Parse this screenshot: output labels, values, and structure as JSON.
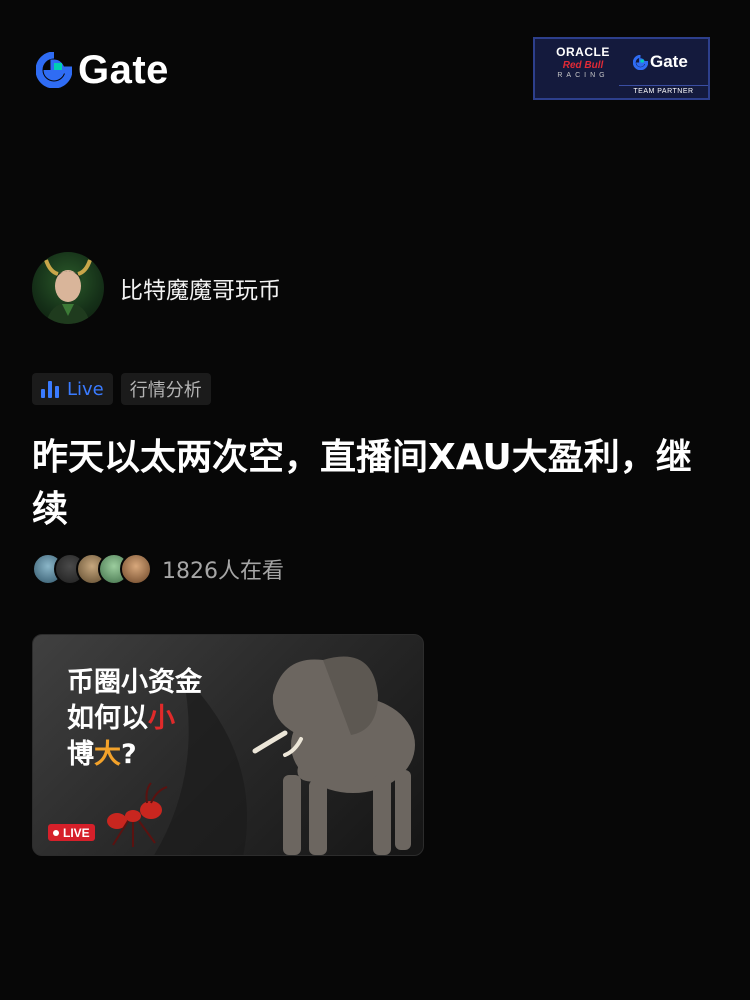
{
  "brand": {
    "name": "Gate",
    "accent": "#00d1b2",
    "blue": "#2f6cf4"
  },
  "partner_badge": {
    "line1": "ORACLE",
    "line2": "Red Bull",
    "line3": "RACING",
    "brand": "Gate",
    "footer": "TEAM PARTNER"
  },
  "author": {
    "name": "比特魔魔哥玩币",
    "avatar_icon": "avatar-icon"
  },
  "tags": {
    "live_label": "Live",
    "live_icon": "bar-chart-icon",
    "category": "行情分析"
  },
  "post": {
    "title": "昨天以太两次空，直播间XAU大盈利，继续"
  },
  "viewers": {
    "count_text": "1826人在看"
  },
  "cover": {
    "line1": "币圈小资金",
    "line2_prefix": "如何以",
    "line2_highlight": "小",
    "line3_highlight": "大",
    "line3_prefix": "博",
    "line3_suffix": "?",
    "live_badge": "LIVE",
    "highlight_red": "#e02a2a",
    "highlight_orange": "#f3a22a"
  }
}
